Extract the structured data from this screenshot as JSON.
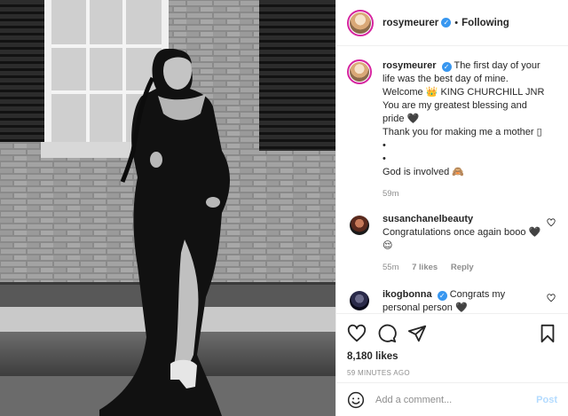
{
  "header": {
    "username": "rosymeurer",
    "dot": "•",
    "follow_label": "Following"
  },
  "caption": {
    "username": "rosymeurer",
    "lines": [
      "The first day of your life was the best day of mine.",
      "Welcome 👑 KING CHURCHILL JNR",
      "You are my greatest blessing and pride 🖤",
      "Thank you for making me a mother ▯",
      "•",
      "•",
      "God is involved 🙈"
    ],
    "time": "59m"
  },
  "comments": [
    {
      "username": "susanchanelbeauty",
      "text": "Congratulations once again booo 🖤😌",
      "time": "55m",
      "likes": "7 likes",
      "reply": "Reply"
    },
    {
      "username": "ikogbonna",
      "text": "Congrats my personal person 🖤",
      "time": "",
      "likes": "",
      "reply": ""
    }
  ],
  "likes": "8,180 likes",
  "timestamp": "59 MINUTES AGO",
  "add_comment": {
    "placeholder": "Add a comment...",
    "post_label": "Post"
  },
  "icons": [
    "heart-icon",
    "comment-icon",
    "share-icon",
    "bookmark-icon",
    "emoji-icon"
  ],
  "colors": {
    "accent": "#3897f0",
    "story_ring": "#d6249f",
    "post_disabled": "#b3dbff"
  }
}
